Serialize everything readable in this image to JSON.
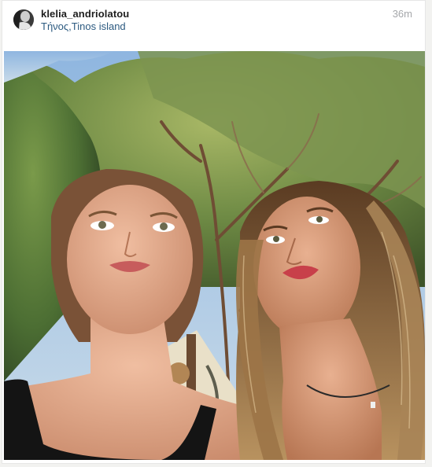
{
  "post": {
    "username": "klelia_andriolatou",
    "location": "Τήνος,Tinos island",
    "timestamp": "36m",
    "avatar_icon": "profile-avatar",
    "photo_subject": "photo"
  },
  "colors": {
    "username": "#1e1e1e",
    "location": "#2c5a80",
    "timestamp": "#a5a7aa",
    "card_background": "#ffffff",
    "page_background": "#f2f2f0"
  }
}
